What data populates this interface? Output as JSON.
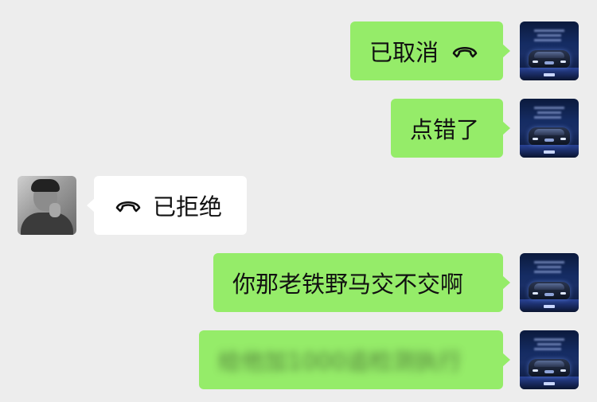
{
  "chat": {
    "messages": [
      {
        "sender": "self",
        "type": "call",
        "text": "已取消",
        "icon": "hangup-phone-icon"
      },
      {
        "sender": "self",
        "type": "text",
        "text": "点错了"
      },
      {
        "sender": "other",
        "type": "call",
        "text": "已拒绝",
        "icon": "hangup-phone-icon"
      },
      {
        "sender": "self",
        "type": "text",
        "text": "你那老铁野马交不交啊"
      },
      {
        "sender": "self",
        "type": "text",
        "text": "给他加1000追检测执行"
      }
    ]
  },
  "colors": {
    "background": "#ededed",
    "self_bubble": "#95ec69",
    "other_bubble": "#ffffff",
    "text": "#111111"
  }
}
